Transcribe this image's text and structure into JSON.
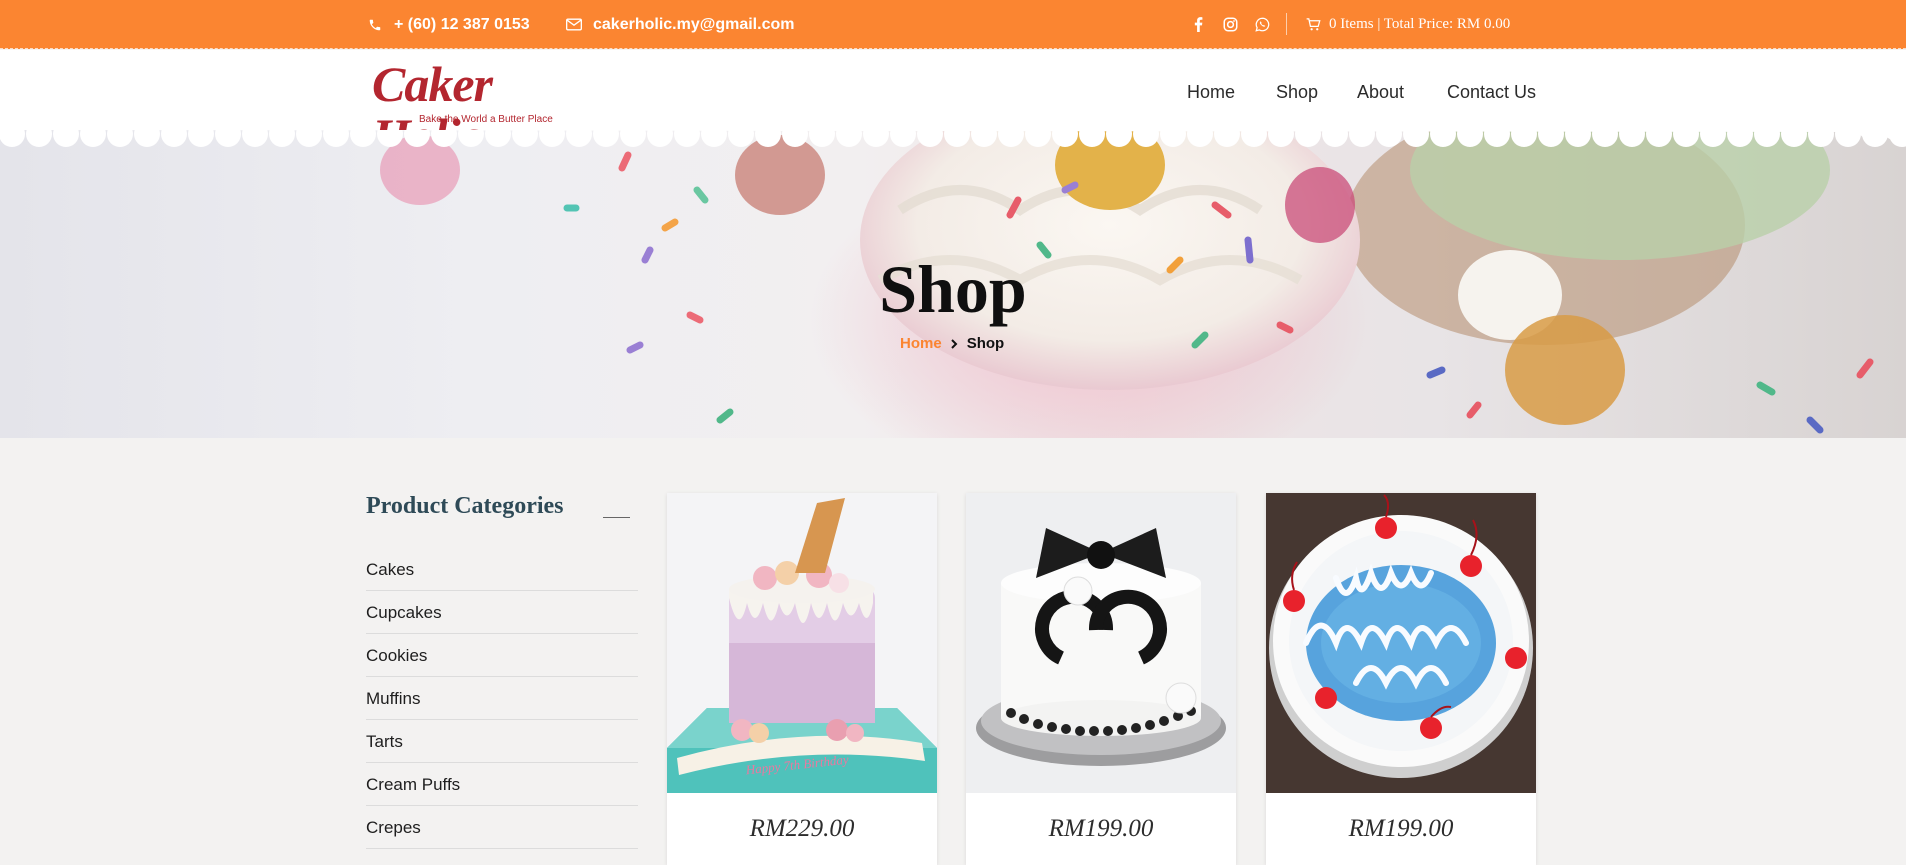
{
  "topbar": {
    "phone": "+ (60) 12 387 0153",
    "email": "cakerholic.my@gmail.com",
    "social": [
      "facebook-icon",
      "instagram-icon",
      "whatsapp-icon"
    ],
    "cart_text": "0 Items | Total Price: RM 0.00"
  },
  "header": {
    "logo_text": "Caker Holic",
    "logo_tagline": "Bake the World a Butter Place",
    "nav": [
      "Home",
      "Shop",
      "About",
      "Contact Us"
    ]
  },
  "hero": {
    "title": "Shop",
    "breadcrumb": [
      "Home",
      "Shop"
    ]
  },
  "sidebar": {
    "title": "Product Categories",
    "categories": [
      "Cakes",
      "Cupcakes",
      "Cookies",
      "Muffins",
      "Tarts",
      "Cream Puffs",
      "Crepes"
    ]
  },
  "products": [
    {
      "price": "RM229.00",
      "image": "unicorn-drip-cake"
    },
    {
      "price": "RM199.00",
      "image": "chanel-bow-cake"
    },
    {
      "price": "RM199.00",
      "image": "happy-birthday-papa-cake"
    }
  ],
  "colors": {
    "accent": "#fb8531",
    "brand": "#b3262f",
    "heading": "#2e4a57"
  }
}
